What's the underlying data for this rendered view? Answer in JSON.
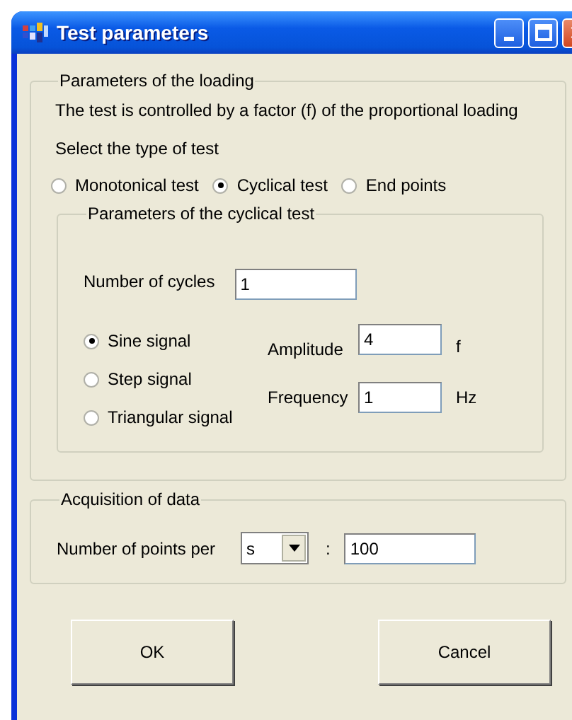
{
  "window": {
    "title": "Test parameters"
  },
  "loading": {
    "title": "Parameters of the loading",
    "description": "The test is controlled by a factor (f) of the proportional loading",
    "prompt": "Select the type of test",
    "test_types": [
      {
        "label": "Monotonical test",
        "selected": false
      },
      {
        "label": "Cyclical test",
        "selected": true
      },
      {
        "label": "End points",
        "selected": false
      }
    ],
    "cyclical": {
      "title": "Parameters of the cyclical test",
      "cycles": {
        "label": "Number of cycles",
        "value": "1"
      },
      "signals": [
        {
          "label": "Sine signal",
          "selected": true
        },
        {
          "label": "Step signal",
          "selected": false
        },
        {
          "label": "Triangular signal",
          "selected": false
        }
      ],
      "amplitude": {
        "label": "Amplitude",
        "value": "4",
        "unit": "f"
      },
      "frequency": {
        "label": "Frequency",
        "value": "1",
        "unit": "Hz"
      }
    }
  },
  "acquisition": {
    "title": "Acquisition of data",
    "points_label": "Number of points per",
    "per_unit": "s",
    "separator": ":",
    "points": "100"
  },
  "buttons": [
    "OK",
    "Cancel"
  ]
}
